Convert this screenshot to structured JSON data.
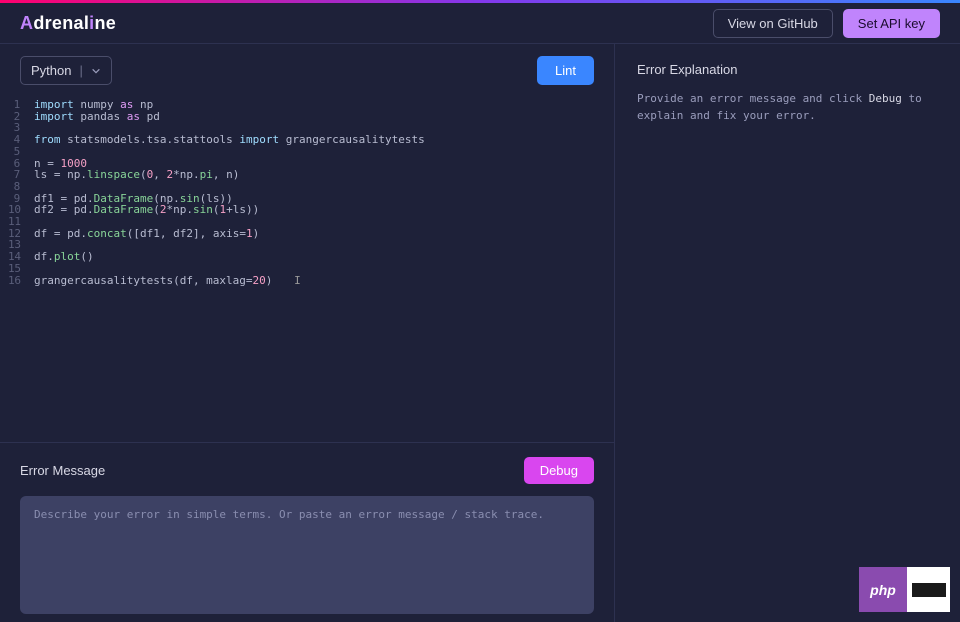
{
  "brand": {
    "a": "A",
    "mid": "drenal",
    "i": "i",
    "end": "ne"
  },
  "topbar": {
    "github": "View on GitHub",
    "apikey": "Set API key"
  },
  "lang": {
    "label": "Python"
  },
  "lint": {
    "label": "Lint"
  },
  "code_lines": [
    [
      {
        "t": "kw",
        "v": "import"
      },
      {
        "t": "p",
        "v": " numpy "
      },
      {
        "t": "as",
        "v": "as"
      },
      {
        "t": "p",
        "v": " np"
      }
    ],
    [
      {
        "t": "kw",
        "v": "import"
      },
      {
        "t": "p",
        "v": " pandas "
      },
      {
        "t": "as",
        "v": "as"
      },
      {
        "t": "p",
        "v": " pd"
      }
    ],
    [],
    [
      {
        "t": "kw",
        "v": "from"
      },
      {
        "t": "p",
        "v": " statsmodels"
      },
      {
        "t": "op",
        "v": "."
      },
      {
        "t": "p",
        "v": "tsa"
      },
      {
        "t": "op",
        "v": "."
      },
      {
        "t": "p",
        "v": "stattools "
      },
      {
        "t": "kw",
        "v": "import"
      },
      {
        "t": "p",
        "v": " grangercausalitytests"
      }
    ],
    [],
    [
      {
        "t": "p",
        "v": "n "
      },
      {
        "t": "op",
        "v": "="
      },
      {
        "t": "p",
        "v": " "
      },
      {
        "t": "num",
        "v": "1000"
      }
    ],
    [
      {
        "t": "p",
        "v": "ls "
      },
      {
        "t": "op",
        "v": "="
      },
      {
        "t": "p",
        "v": " np"
      },
      {
        "t": "op",
        "v": "."
      },
      {
        "t": "fn",
        "v": "linspace"
      },
      {
        "t": "p",
        "v": "("
      },
      {
        "t": "num",
        "v": "0"
      },
      {
        "t": "p",
        "v": ", "
      },
      {
        "t": "num",
        "v": "2"
      },
      {
        "t": "op",
        "v": "*"
      },
      {
        "t": "p",
        "v": "np"
      },
      {
        "t": "op",
        "v": "."
      },
      {
        "t": "attr",
        "v": "pi"
      },
      {
        "t": "p",
        "v": ", n)"
      }
    ],
    [],
    [
      {
        "t": "p",
        "v": "df1 "
      },
      {
        "t": "op",
        "v": "="
      },
      {
        "t": "p",
        "v": " pd"
      },
      {
        "t": "op",
        "v": "."
      },
      {
        "t": "fn",
        "v": "DataFrame"
      },
      {
        "t": "p",
        "v": "(np"
      },
      {
        "t": "op",
        "v": "."
      },
      {
        "t": "fn",
        "v": "sin"
      },
      {
        "t": "p",
        "v": "(ls))"
      }
    ],
    [
      {
        "t": "p",
        "v": "df2 "
      },
      {
        "t": "op",
        "v": "="
      },
      {
        "t": "p",
        "v": " pd"
      },
      {
        "t": "op",
        "v": "."
      },
      {
        "t": "fn",
        "v": "DataFrame"
      },
      {
        "t": "p",
        "v": "("
      },
      {
        "t": "num",
        "v": "2"
      },
      {
        "t": "op",
        "v": "*"
      },
      {
        "t": "p",
        "v": "np"
      },
      {
        "t": "op",
        "v": "."
      },
      {
        "t": "fn",
        "v": "sin"
      },
      {
        "t": "p",
        "v": "("
      },
      {
        "t": "num",
        "v": "1"
      },
      {
        "t": "op",
        "v": "+"
      },
      {
        "t": "p",
        "v": "ls))"
      }
    ],
    [],
    [
      {
        "t": "p",
        "v": "df "
      },
      {
        "t": "op",
        "v": "="
      },
      {
        "t": "p",
        "v": " pd"
      },
      {
        "t": "op",
        "v": "."
      },
      {
        "t": "fn",
        "v": "concat"
      },
      {
        "t": "p",
        "v": "([df1, df2], axis"
      },
      {
        "t": "op",
        "v": "="
      },
      {
        "t": "num",
        "v": "1"
      },
      {
        "t": "p",
        "v": ")"
      }
    ],
    [],
    [
      {
        "t": "p",
        "v": "df"
      },
      {
        "t": "op",
        "v": "."
      },
      {
        "t": "fn",
        "v": "plot"
      },
      {
        "t": "p",
        "v": "()"
      }
    ],
    [],
    [
      {
        "t": "p",
        "v": "grangercausalitytests(df, maxlag"
      },
      {
        "t": "op",
        "v": "="
      },
      {
        "t": "num",
        "v": "20"
      },
      {
        "t": "p",
        "v": ")"
      }
    ]
  ],
  "cursor_line": 16,
  "error": {
    "title": "Error Message",
    "debug": "Debug",
    "placeholder": "Describe your error in simple terms. Or paste an error message / stack trace."
  },
  "explain": {
    "title": "Error Explanation",
    "body_pre": "Provide an error message and click ",
    "body_hl": "Debug",
    "body_post": " to explain and fix your error."
  },
  "badge": {
    "text": "php"
  }
}
